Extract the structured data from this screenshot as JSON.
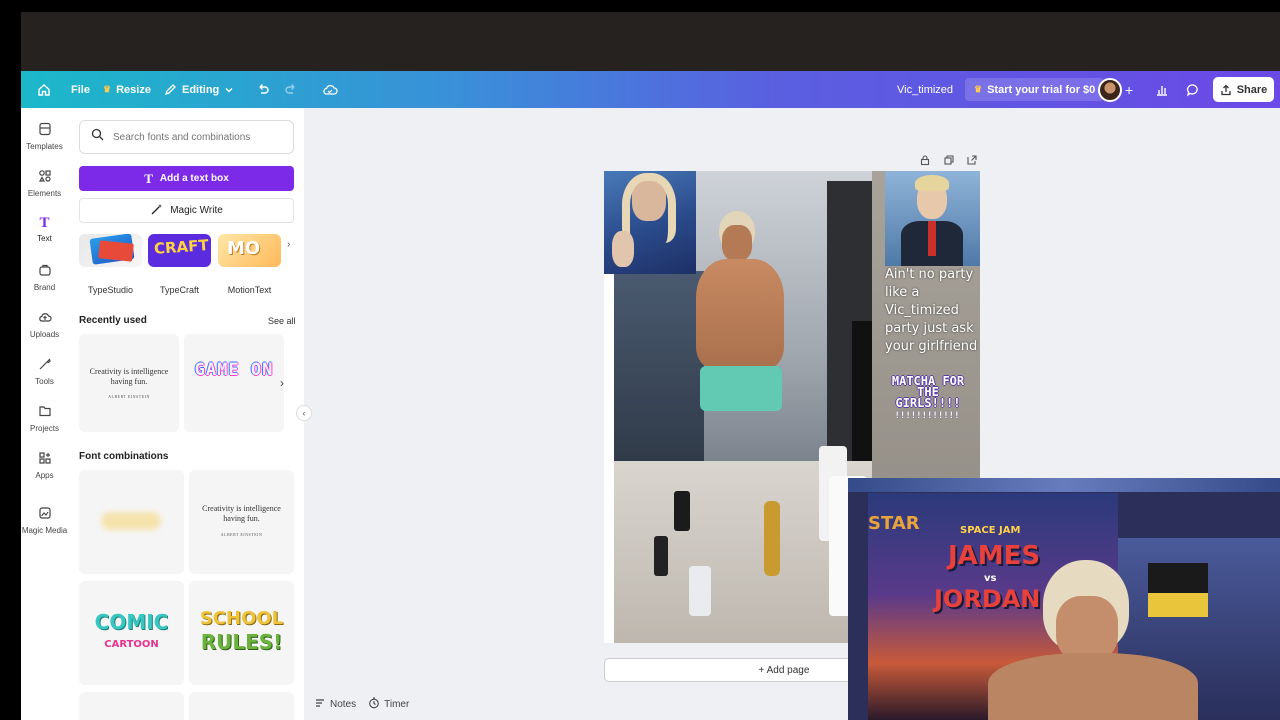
{
  "topbar": {
    "file": "File",
    "resize": "Resize",
    "editing": "Editing",
    "project_name": "Vic_timized",
    "trial": "Start your trial for $0",
    "share": "Share"
  },
  "rail": [
    {
      "label": "Templates",
      "icon": "templates-icon"
    },
    {
      "label": "Elements",
      "icon": "elements-icon"
    },
    {
      "label": "Text",
      "icon": "text-icon"
    },
    {
      "label": "Brand",
      "icon": "brand-icon"
    },
    {
      "label": "Uploads",
      "icon": "uploads-icon"
    },
    {
      "label": "Tools",
      "icon": "tools-icon"
    },
    {
      "label": "Projects",
      "icon": "projects-icon"
    },
    {
      "label": "Apps",
      "icon": "apps-icon"
    },
    {
      "label": "Magic Media",
      "icon": "magic-media-icon"
    }
  ],
  "panel": {
    "search_placeholder": "Search fonts and combinations",
    "add_text_box": "Add a text box",
    "magic_write": "Magic Write",
    "apps": [
      "TypeStudio",
      "TypeCraft",
      "MotionText"
    ],
    "app_thumb_texts": [
      "CRAFT",
      "MO"
    ],
    "recently_used": "Recently used",
    "see_all": "See all",
    "recent_quote": "Creativity is intelligence having fun.",
    "recent_author": "ALBERT EINSTEIN",
    "recent_game": "GAME ON",
    "font_combinations": "Font combinations",
    "combo_quote": "Creativity is intelligence having fun.",
    "combo_author": "ALBERT EINSTEIN",
    "combo_comic": "COMIC",
    "combo_cartoon": "CARTOON",
    "combo_school": "SCHOOL",
    "combo_rules": "RULES!"
  },
  "canvas": {
    "caption_1": "Ain't no party like a Vic_timized party just ask your girlfriend",
    "caption_2": "MATCHA FOR THE GIRLS!!!!",
    "caption_3": "!!!!!!!!!!!!",
    "add_page": "+ Add page",
    "notes": "Notes",
    "timer": "Timer"
  },
  "webcam": {
    "poster_text_1": "SPACE JAM",
    "poster_text_2": "JAMES",
    "poster_text_3": "vs",
    "poster_text_4": "JORDAN",
    "poster_text_5": "STAR"
  },
  "colors": {
    "accent": "#7d2ae8",
    "topbar_start": "#1bb8c9",
    "topbar_end": "#6a49e6"
  }
}
